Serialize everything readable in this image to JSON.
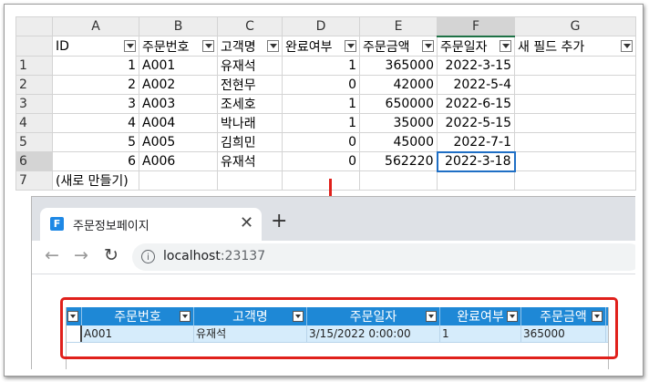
{
  "sheet": {
    "columns": [
      "A",
      "B",
      "C",
      "D",
      "E",
      "F",
      "G"
    ],
    "rows": [
      "1",
      "2",
      "3",
      "4",
      "5",
      "6",
      "7"
    ],
    "headers": [
      "ID",
      "주문번호",
      "고객명",
      "완료여부",
      "주문금액",
      "주문일자",
      "새 필드 추가"
    ],
    "data": [
      [
        "1",
        "A001",
        "유재석",
        "1",
        "365000",
        "2022-3-15"
      ],
      [
        "2",
        "A002",
        "전현무",
        "0",
        "42000",
        "2022-5-4"
      ],
      [
        "3",
        "A003",
        "조세호",
        "1",
        "650000",
        "2022-6-15"
      ],
      [
        "4",
        "A004",
        "박나래",
        "1",
        "35000",
        "2022-5-15"
      ],
      [
        "5",
        "A005",
        "김희민",
        "0",
        "45000",
        "2022-7-1"
      ],
      [
        "6",
        "A006",
        "유재석",
        "0",
        "562220",
        "2022-3-18"
      ]
    ],
    "new_row_label": "(새로 만들기)"
  },
  "browser": {
    "tab_title": "주문정보페이지",
    "favicon_letter": "F",
    "close_glyph": "✕",
    "newtab_glyph": "+",
    "url_host": "localhost",
    "url_port": ":23137",
    "back_glyph": "←",
    "forward_glyph": "→",
    "reload_glyph": "↻",
    "info_glyph": "i"
  },
  "grid": {
    "headers": [
      "주문번호",
      "고객명",
      "주문일자",
      "완료여부",
      "주문금액"
    ],
    "row": [
      "A001",
      "유재석",
      "3/15/2022 0:00:00",
      "1",
      "365000"
    ]
  },
  "colors": {
    "accent_red": "#e0201b",
    "grid_header_blue": "#1e88d6",
    "grid_row_blue": "#d6ecfb",
    "active_cell_blue": "#1f6fc5"
  }
}
